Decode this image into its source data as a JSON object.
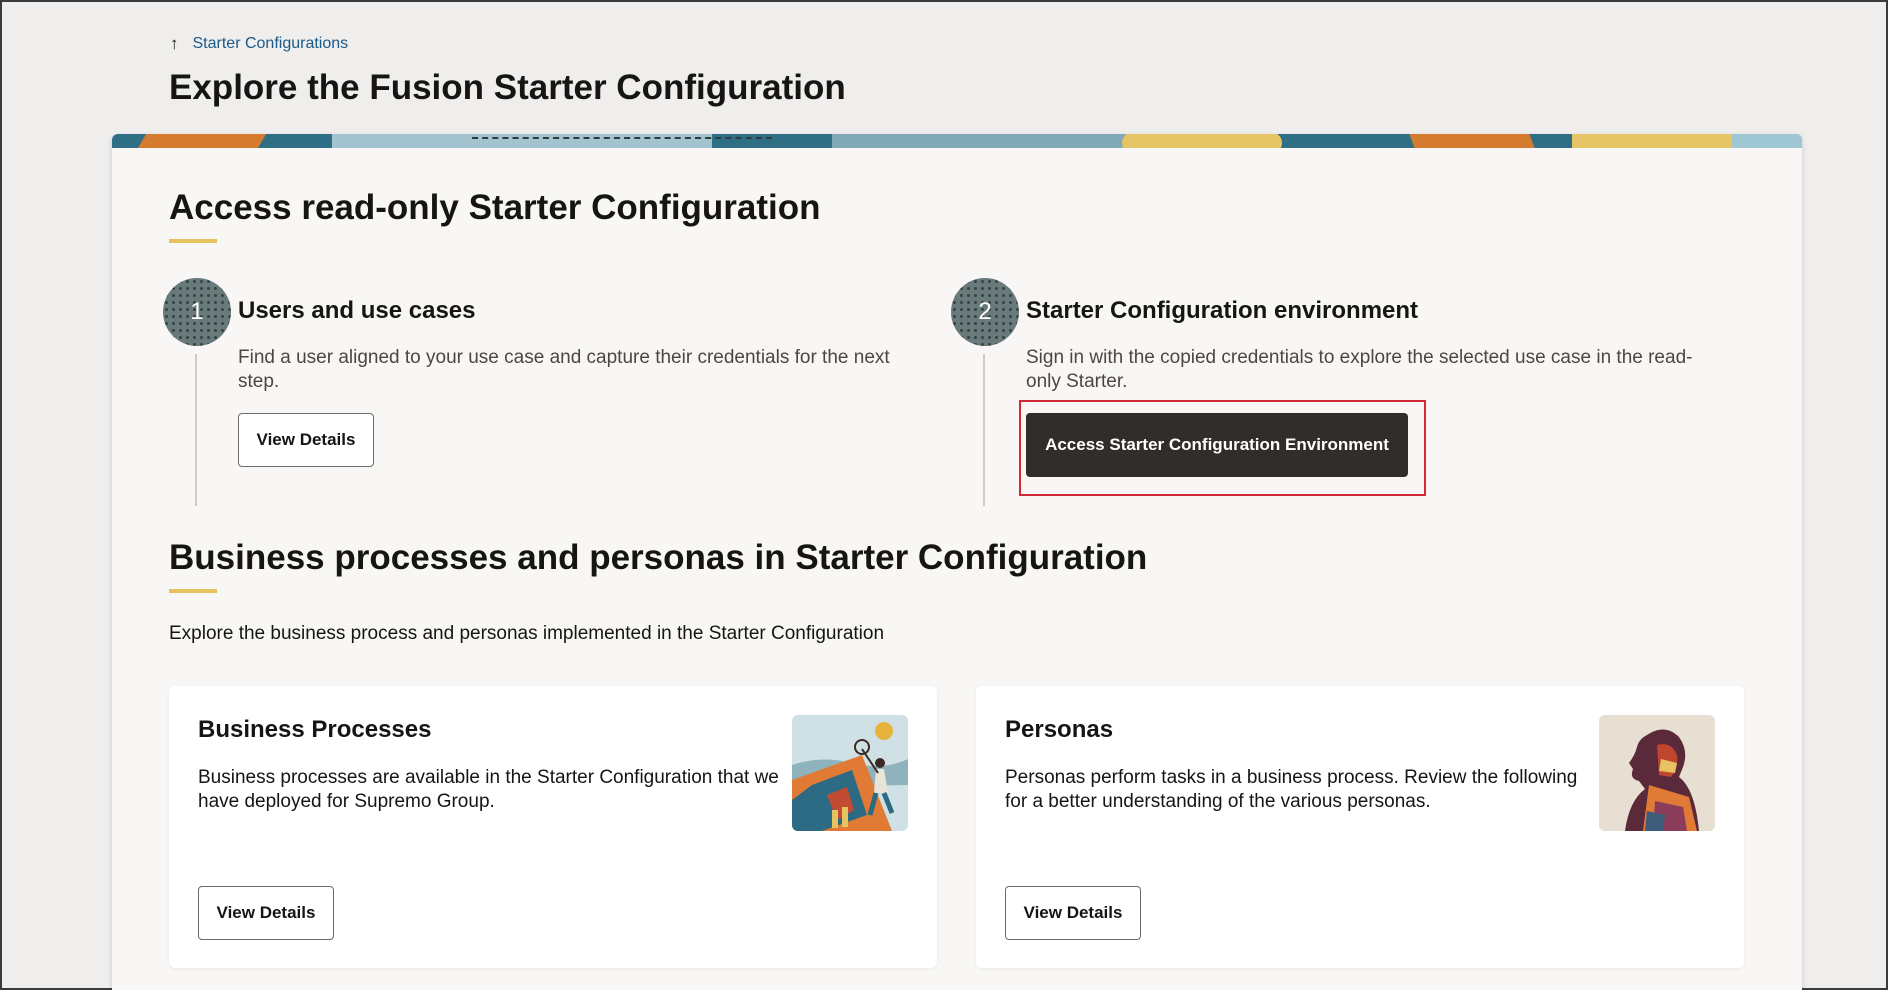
{
  "breadcrumb": {
    "label": "Starter Configurations",
    "icon": "arrow-up-icon"
  },
  "page": {
    "title": "Explore the Fusion Starter Configuration"
  },
  "access_section": {
    "title": "Access read-only Starter Configuration",
    "steps": [
      {
        "number": "1",
        "title": "Users and use cases",
        "description": "Find a user aligned to your use case and capture their credentials for the next step.",
        "button": "View Details"
      },
      {
        "number": "2",
        "title": "Starter Configuration environment",
        "description": "Sign in with the copied credentials to explore the selected use case in the read-only Starter.",
        "button": "Access Starter Configuration Environment"
      }
    ]
  },
  "business_section": {
    "title": "Business processes and personas in Starter Configuration",
    "intro": "Explore the business process and personas implemented in the Starter Configuration",
    "cards": [
      {
        "title": "Business Processes",
        "description": "Business processes are available in the Starter Configuration that we have deployed for Supremo Group.",
        "button": "View Details"
      },
      {
        "title": "Personas",
        "description": "Personas perform tasks in a business process. Review the following for a better understanding of the various personas.",
        "button": "View Details"
      }
    ]
  },
  "colors": {
    "accent": "#e6c361",
    "dark_button": "#312d2a",
    "link": "#1b5a87",
    "highlight": "#d12c35"
  }
}
